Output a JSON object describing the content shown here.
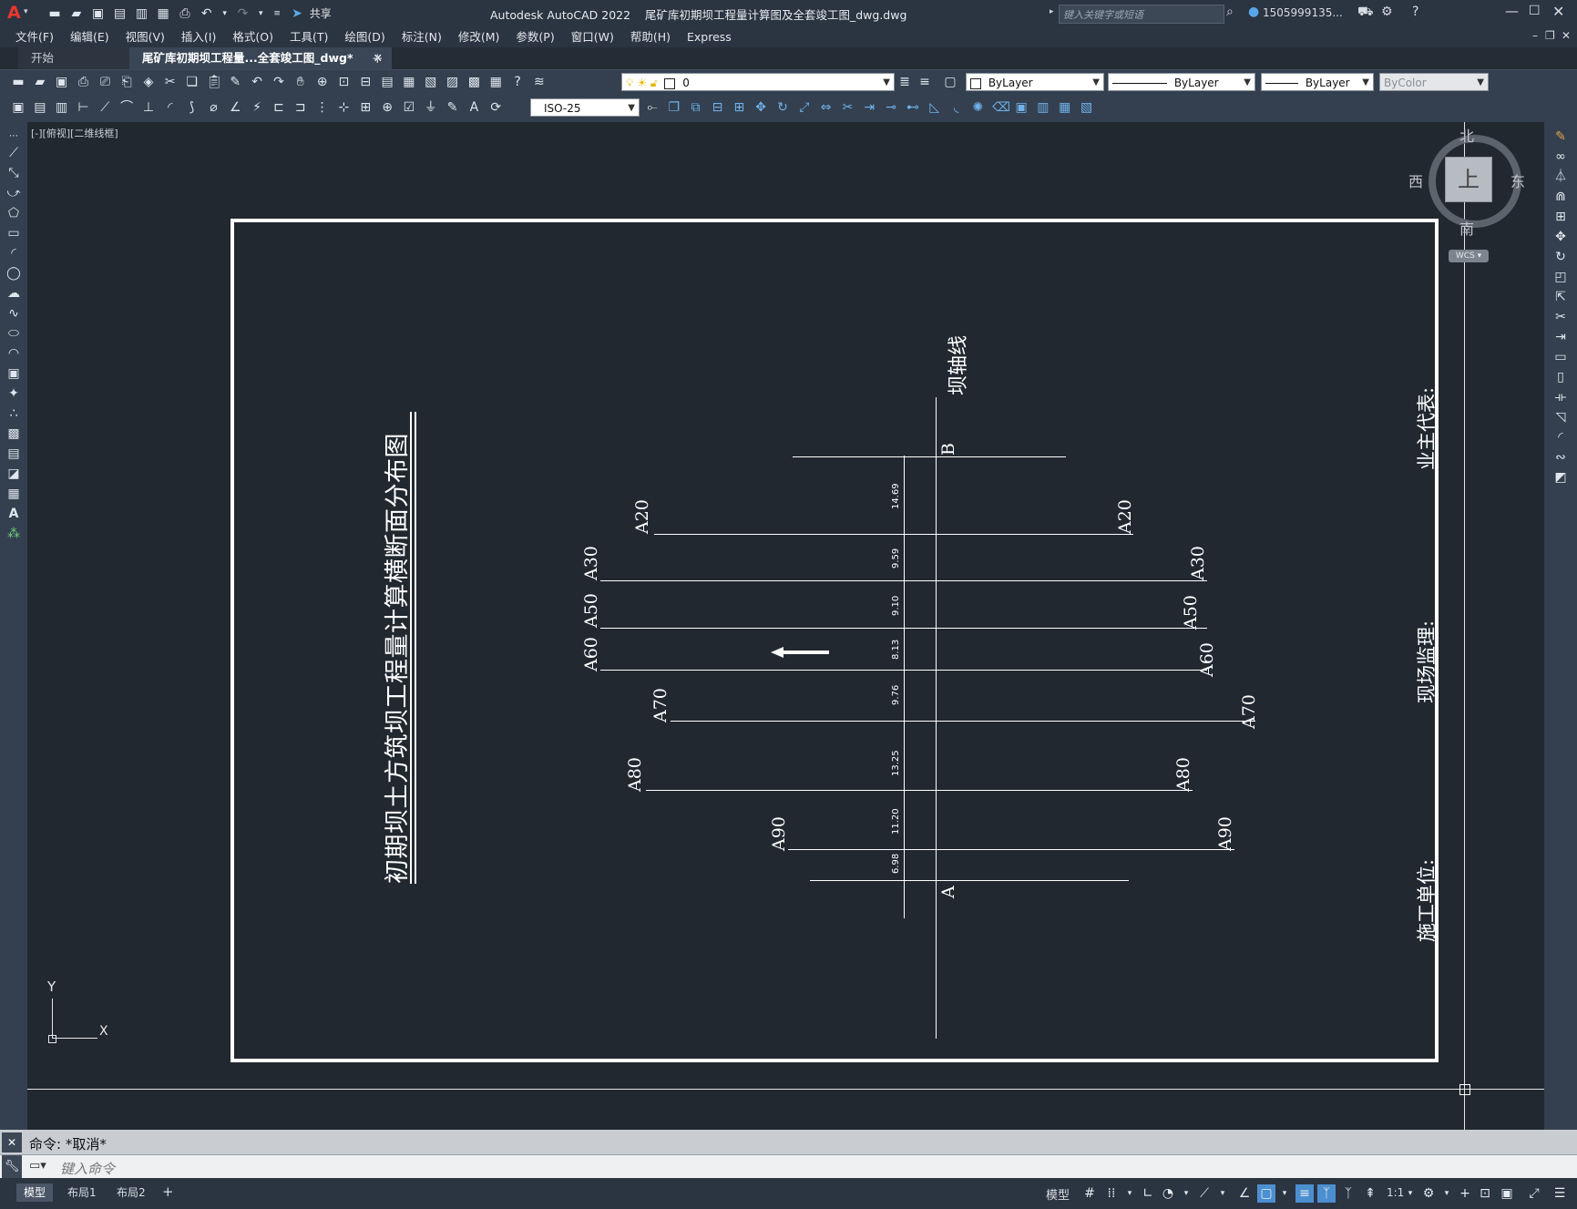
{
  "app": {
    "title": "Autodesk AutoCAD 2022    尾矿库初期坝工程量计算图及全套竣工图_dwg.dwg",
    "logo": "A",
    "share_label": "共享",
    "search_placeholder": "键入关键字或短语",
    "user": "1505999135...",
    "window_controls": [
      "minimize-icon",
      "maximize-icon",
      "close-icon"
    ]
  },
  "menu": [
    "文件(F)",
    "编辑(E)",
    "视图(V)",
    "插入(I)",
    "格式(O)",
    "工具(T)",
    "绘图(D)",
    "标注(N)",
    "修改(M)",
    "参数(P)",
    "窗口(W)",
    "帮助(H)",
    "Express"
  ],
  "file_tabs": [
    {
      "label": "开始",
      "active": false
    },
    {
      "label": "尾矿库初期坝工程量...全套竣工图_dwg*",
      "active": true
    }
  ],
  "toolbar": {
    "layer_value": "0",
    "color_value": "ByLayer",
    "linetype_value": "ByLayer",
    "lineweight_value": "ByLayer",
    "plotstyle_value": "ByColor",
    "dimstyle_value": "ISO-25"
  },
  "viewport": {
    "label": "[-][俯视][二维线框]",
    "viewcube": {
      "north": "北",
      "south": "南",
      "east": "东",
      "west": "西",
      "top": "上",
      "ucs": "WCS"
    },
    "ucs_axis_y": "Y",
    "ucs_axis_x": "X"
  },
  "drawing": {
    "title": "初期坝土方筑坝工程量计算横断面分布图",
    "axis_label": "坝轴线",
    "point_b": "B",
    "point_a": "A",
    "sections": [
      {
        "name": "A20",
        "spacing": "14.69"
      },
      {
        "name": "A30",
        "spacing": "9.59"
      },
      {
        "name": "A50",
        "spacing": "9.10"
      },
      {
        "name": "A60",
        "spacing": "8.13"
      },
      {
        "name": "A70",
        "spacing": "9.76"
      },
      {
        "name": "A80",
        "spacing": "13.25"
      },
      {
        "name": "A90",
        "spacing": "11.20"
      },
      {
        "name": "A",
        "spacing": "6.98"
      }
    ],
    "sign_owner": "业主代表:",
    "sign_supervisor": "现场监理:",
    "sign_contractor": "施工单位:"
  },
  "command": {
    "history": "命令: *取消*",
    "placeholder": "键入命令"
  },
  "status": {
    "layout_tabs": [
      "模型",
      "布局1",
      "布局2"
    ],
    "model_label": "模型",
    "scale": "1:1"
  }
}
